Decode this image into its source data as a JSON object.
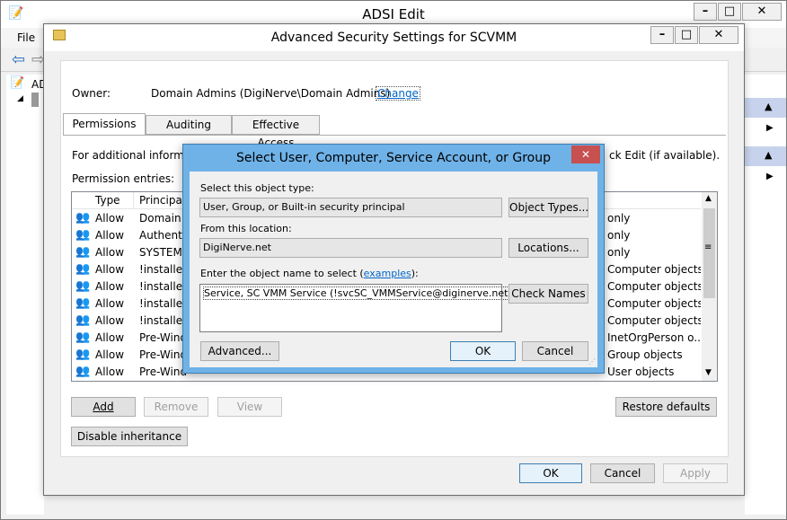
{
  "adsi": {
    "title": "ADSI Edit",
    "menu_file": "File",
    "tree_root": "AD",
    "minimize": "–",
    "maximize": "□",
    "close": "✕"
  },
  "adv": {
    "title": "Advanced Security Settings for SCVMM",
    "owner_label": "Owner:",
    "owner_value": "Domain Admins (DigiNerve\\Domain Admins)",
    "change_link": "Change",
    "tabs": [
      "Permissions",
      "Auditing",
      "Effective Access"
    ],
    "info_left": "For additional informati",
    "info_right": "ck Edit (if available).",
    "entries_label": "Permission entries:",
    "col_type": "Type",
    "col_principal": "Principal",
    "rows": [
      {
        "type": "Allow",
        "principal": "Domain A",
        "applies": "only"
      },
      {
        "type": "Allow",
        "principal": "Authentic",
        "applies": "only"
      },
      {
        "type": "Allow",
        "principal": "SYSTEM",
        "applies": "only"
      },
      {
        "type": "Allow",
        "principal": "!installer",
        "applies": "Computer objects"
      },
      {
        "type": "Allow",
        "principal": "!installer",
        "applies": "Computer objects"
      },
      {
        "type": "Allow",
        "principal": "!installer",
        "applies": "Computer objects"
      },
      {
        "type": "Allow",
        "principal": "!installer",
        "applies": "Computer objects"
      },
      {
        "type": "Allow",
        "principal": "Pre-Wind",
        "applies": "InetOrgPerson o..."
      },
      {
        "type": "Allow",
        "principal": "Pre-Wind",
        "applies": "Group objects"
      },
      {
        "type": "Allow",
        "principal": "Pre-Wind",
        "applies": "User objects"
      }
    ],
    "add": "Add",
    "remove": "Remove",
    "view": "View",
    "restore": "Restore defaults",
    "disable_inherit": "Disable inheritance",
    "ok": "OK",
    "cancel": "Cancel",
    "apply": "Apply"
  },
  "sel": {
    "title": "Select User, Computer, Service Account, or Group",
    "close": "✕",
    "object_type_label": "Select this object type:",
    "object_type_value": "User, Group, or Built-in security principal",
    "object_types_btn": "Object Types...",
    "location_label": "From this location:",
    "location_value": "DigiNerve.net",
    "locations_btn": "Locations...",
    "enter_label_pre": "Enter the object name to select (",
    "examples": "examples",
    "enter_label_post": "):",
    "name_value": "Service, SC VMM Service (!svcSC_VMMService@diginerve.net)",
    "check_names": "Check Names",
    "advanced": "Advanced...",
    "ok": "OK",
    "cancel": "Cancel"
  }
}
